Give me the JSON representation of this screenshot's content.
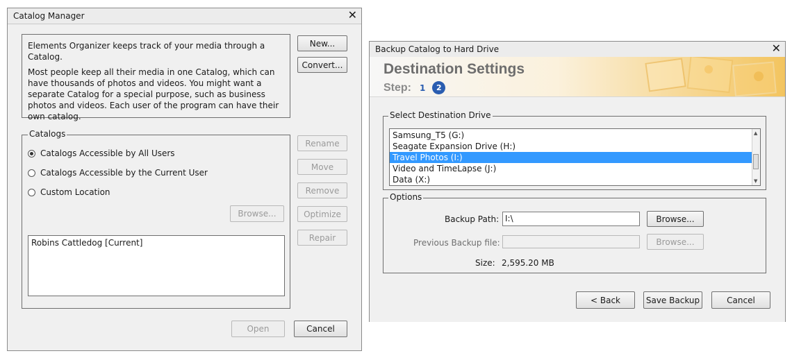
{
  "catalog_manager": {
    "title": "Catalog Manager",
    "info_text_1": "Elements Organizer keeps track of your media through a Catalog.",
    "info_text_2": "Most people keep all their media in one Catalog, which can have thousands of photos and videos. You might want a separate Catalog for a special purpose, such as business photos and videos. Each user of the program can have their own catalog.",
    "new_label": "New...",
    "convert_label": "Convert...",
    "catalogs_legend": "Catalogs",
    "radio_all_users": "Catalogs Accessible by All Users",
    "radio_current_user": "Catalogs Accessible by the Current User",
    "radio_custom": "Custom Location",
    "browse_label": "Browse...",
    "catalog_list": [
      "Robins Cattledog [Current]"
    ],
    "rename_label": "Rename",
    "move_label": "Move",
    "remove_label": "Remove",
    "optimize_label": "Optimize",
    "repair_label": "Repair",
    "open_label": "Open",
    "cancel_label": "Cancel"
  },
  "backup_dialog": {
    "title": "Backup Catalog to Hard Drive",
    "heading": "Destination Settings",
    "step_label": "Step:",
    "step_1": "1",
    "step_2": "2",
    "destination_legend": "Select Destination Drive",
    "drives": [
      "Samsung_T5 (G:)",
      "Seagate Expansion Drive (H:)",
      "Travel Photos (I:)",
      "Video and TimeLapse (J:)",
      "Data (X:)"
    ],
    "options_legend": "Options",
    "backup_path_label": "Backup Path:",
    "backup_path_value": "I:\\",
    "browse_label": "Browse...",
    "previous_backup_label": "Previous Backup file:",
    "previous_browse_label": "Browse...",
    "size_label": "Size:",
    "size_value": "2,595.20 MB",
    "back_label": "< Back",
    "save_label": "Save Backup",
    "cancel_label": "Cancel"
  },
  "colors": {
    "selection": "#3399ff",
    "step_active": "#2a5db0",
    "heading": "#6d6d6d"
  }
}
